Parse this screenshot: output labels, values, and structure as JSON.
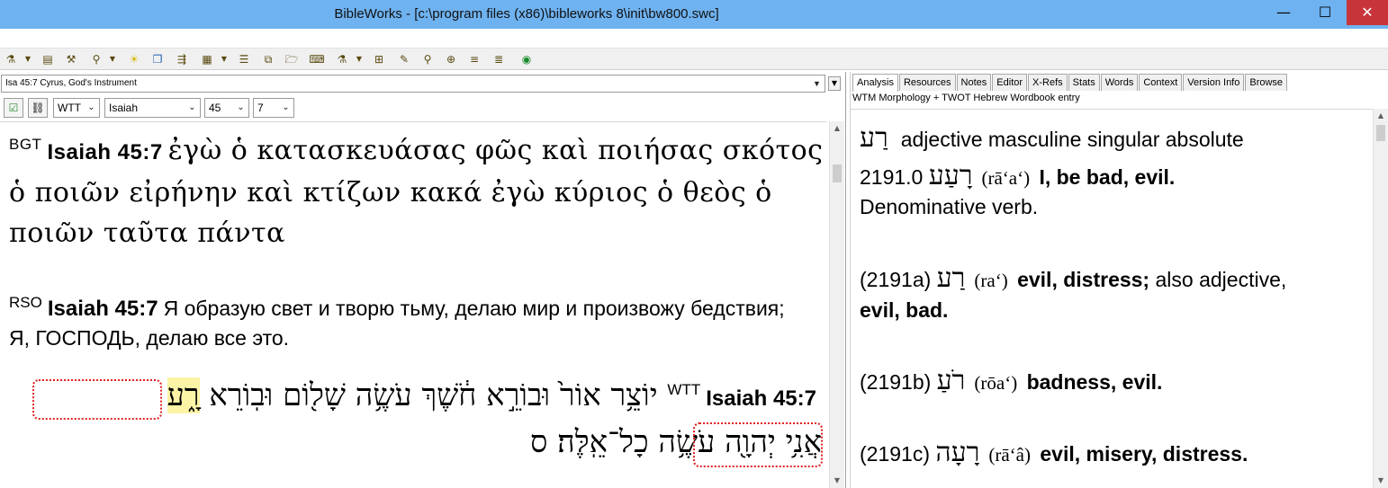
{
  "window": {
    "title": "BibleWorks - [c:\\program files (x86)\\bibleworks 8\\init\\bw800.swc]",
    "minimize_glyph": "—",
    "maximize_glyph": "☐",
    "close_glyph": "✕"
  },
  "left": {
    "verse_selector": "Isa 45:7 Cyrus, God's Instrument",
    "version_combo": "WTT",
    "book_combo": "Isaiah",
    "chapter_combo": "45",
    "verse_combo": "7",
    "bgt": {
      "label": "BGT",
      "ref": "Isaiah 45:7",
      "text": "ἐγὼ ὁ κατασκευάσας φῶς καὶ ποιήσας σκότος ὁ ποιῶν εἰρήνην καὶ κτίζων κακά ἐγὼ κύριος ὁ θεὸς ὁ ποιῶν ταῦτα πάντα"
    },
    "rso": {
      "label": "RSO",
      "ref": "Isaiah 45:7",
      "text": "Я образую свет и творю тьму, делаю мир и произвожу бедствия; Я, ГОСПОДЬ, делаю все это."
    },
    "wtt": {
      "label": "WTT",
      "ref": "Isaiah 45:7",
      "line1_text": "יוֹצֵ֥ר אוֹר֙ וּבוֹרֵ֣א חֹ֔שֶׁךְ עֹשֶׂ֥ה שָׁל֖וֹם וּבֽוֹרֵא",
      "highlight_word": "רָ֑ע",
      "line2_text": "עֹשֶׂ֥ה כָל־אֵֽלֶּה׃ ס",
      "line2_boxed_word": "אֲנִ֥י יְהוָ֖ה"
    }
  },
  "right": {
    "tabs": [
      "Analysis",
      "Resources",
      "Notes",
      "Editor",
      "X-Refs",
      "Stats",
      "Words",
      "Context",
      "Version Info",
      "Browse"
    ],
    "header": "WTM Morphology + TWOT Hebrew Wordbook entry",
    "entry1": {
      "heb": "רַע",
      "text": "adjective masculine singular absolute"
    },
    "entry2": {
      "num": "2191.0",
      "heb": "רָעַע",
      "translit": "(rā‘a‘)",
      "gloss": "I, be bad, evil.",
      "note": "Denominative verb."
    },
    "entry3": {
      "num": "(2191a)",
      "heb": "רַע",
      "translit": "(ra‘)",
      "gloss": "evil, distress;",
      "rest": "also adjective,",
      "gloss2": "evil, bad."
    },
    "entry4": {
      "num": "(2191b)",
      "heb": "רֹעַ",
      "translit": "(rōa‘)",
      "gloss": "badness, evil."
    },
    "entry5": {
      "num": "(2191c)",
      "heb": "רָעָה",
      "translit": "(rā‘â)",
      "gloss": "evil, misery, distress."
    }
  }
}
